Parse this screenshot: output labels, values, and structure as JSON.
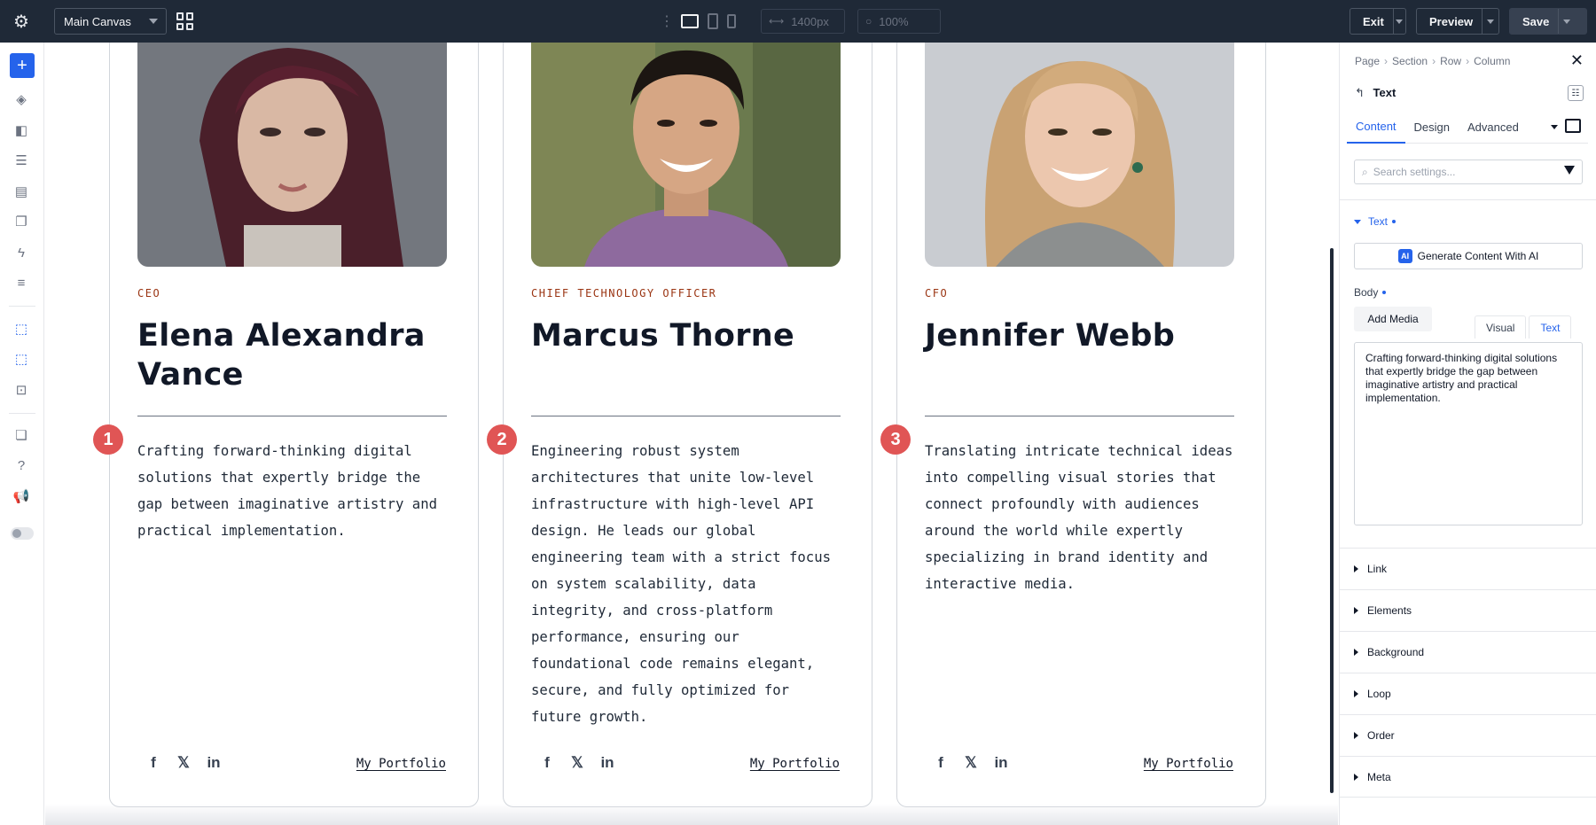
{
  "topbar": {
    "canvas_select": "Main Canvas",
    "width_value": "1400px",
    "zoom_value": "100%",
    "exit_label": "Exit",
    "preview_label": "Preview",
    "save_label": "Save"
  },
  "team": [
    {
      "badge": "1",
      "role": "CEO",
      "name": "Elena Alexandra Vance",
      "bio": "Crafting forward-thinking digital solutions that expertly bridge the gap between imaginative artistry and practical implementation.",
      "portfolio": "My Portfolio"
    },
    {
      "badge": "2",
      "role": "CHIEF TECHNOLOGY OFFICER",
      "name": "Marcus Thorne",
      "bio": "Engineering robust system architectures that unite low-level infrastructure with high-level API design. He leads our global engineering team with a strict focus on system scalability, data integrity, and cross-platform performance, ensuring our foundational code remains elegant, secure, and fully optimized for future growth.",
      "portfolio": "My Portfolio"
    },
    {
      "badge": "3",
      "role": "CFO",
      "name": "Jennifer Webb",
      "bio": "Translating intricate technical ideas into compelling visual stories that connect profoundly with audiences around the world while expertly specializing in brand identity and interactive media.",
      "portfolio": "My Portfolio"
    }
  ],
  "panel": {
    "breadcrumbs": [
      "Page",
      "Section",
      "Row",
      "Column"
    ],
    "element_title": "Text",
    "tabs": [
      "Content",
      "Design",
      "Advanced"
    ],
    "search_placeholder": "Search settings...",
    "group_open": "Text",
    "ai_button": "Generate Content With AI",
    "ai_badge": "AI",
    "body_label": "Body",
    "add_media": "Add Media",
    "mode_visual": "Visual",
    "mode_text": "Text",
    "body_value": "Crafting forward-thinking digital solutions that expertly bridge the gap between imaginative artistry and practical implementation.",
    "groups": [
      "Link",
      "Elements",
      "Background",
      "Loop",
      "Order",
      "Meta"
    ]
  },
  "colors": {
    "accent": "#2563eb",
    "topbar": "#1f2937",
    "badge": "#e05555",
    "role_text": "#9a3412"
  }
}
